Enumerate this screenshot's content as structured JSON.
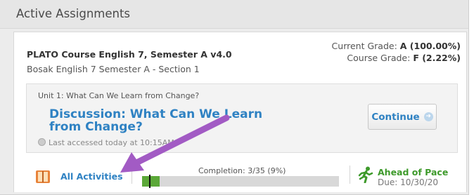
{
  "panel": {
    "title": "Active Assignments"
  },
  "course": {
    "name": "PLATO Course English 7, Semester A v4.0",
    "section": "Bosak English 7 Semester A - Section 1",
    "current_grade_label": "Current Grade:",
    "current_grade_value": "A (100.00%)",
    "course_grade_label": "Course Grade:",
    "course_grade_value": "F (2.22%)"
  },
  "unit": {
    "label": "Unit 1: What Can We Learn from Change?",
    "activity_title": "Discussion: What Can We Learn from Change?",
    "last_accessed": "Last accessed today at 10:15AM",
    "continue_label": "Continue"
  },
  "footer": {
    "all_activities_label": "All Activities",
    "completion_label": "Completion: 3/35 (9%)",
    "completion_fraction": 0.09,
    "pace_label": "Ahead of Pace",
    "due_label": "Due: 10/30/20"
  },
  "icons": {
    "book": "book-icon",
    "clock": "clock-icon",
    "continue_arrow": "arrow-right-circle-icon",
    "runner": "runner-icon",
    "annotation_arrow": "purple-arrow-annotation"
  },
  "colors": {
    "link": "#2f82c3",
    "progress": "#5ba838",
    "pace": "#3e9a2b",
    "annotation": "#a25bc4"
  }
}
